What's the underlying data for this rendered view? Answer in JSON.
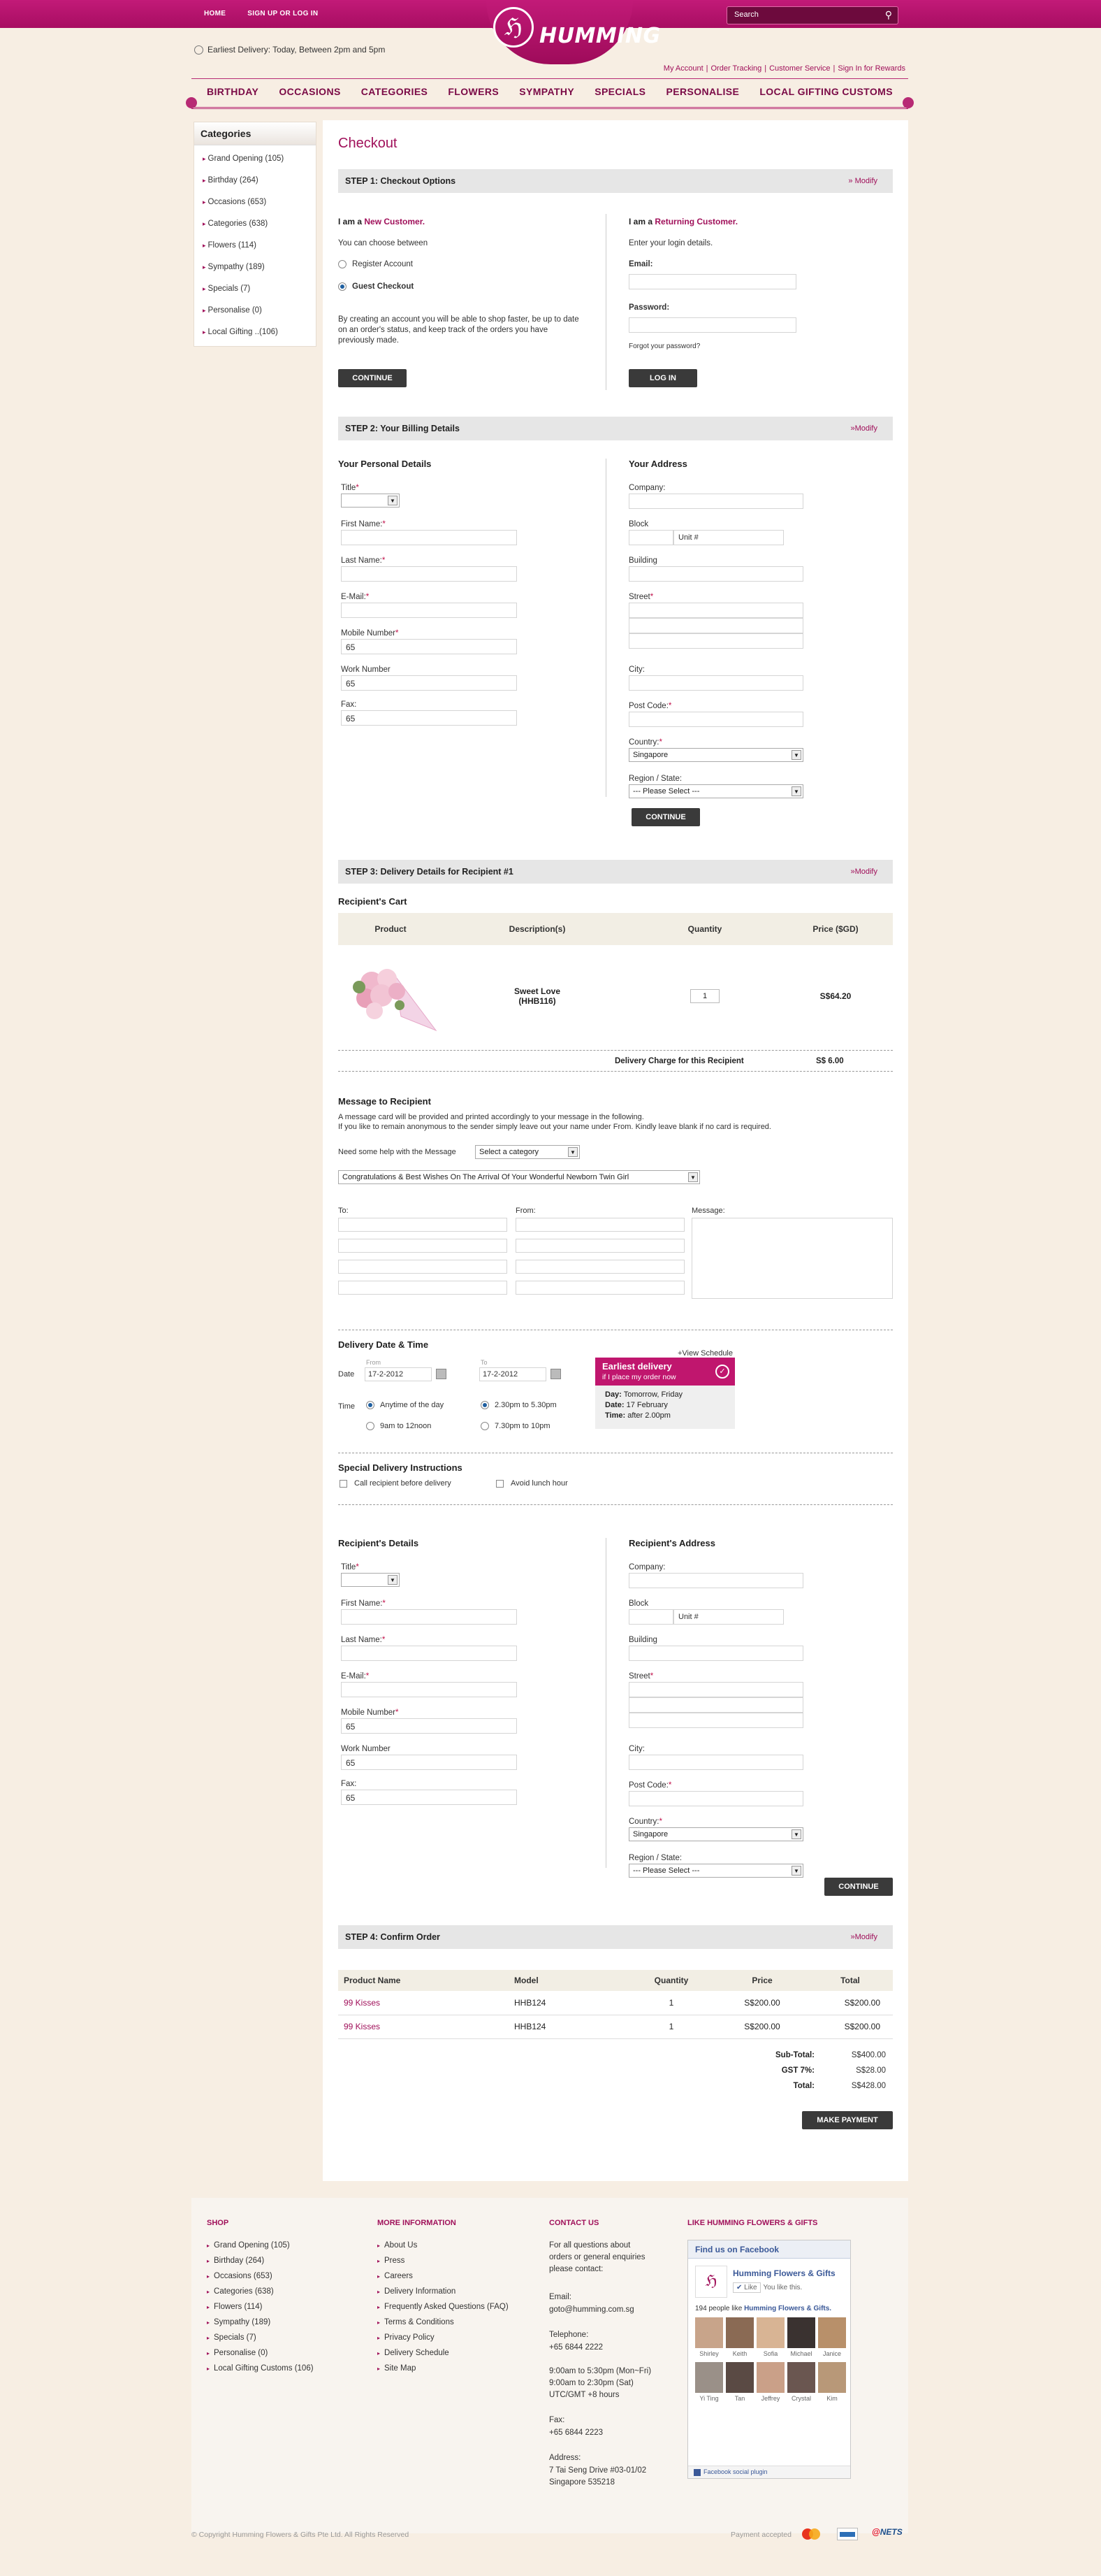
{
  "topnav": {
    "home": "HOME",
    "signup": "SIGN UP OR LOG IN"
  },
  "logo": {
    "text": "HUMMING",
    "mark": "ℌ"
  },
  "search": {
    "placeholder": "Search",
    "icon": "search-icon"
  },
  "earliest_delivery": "Earliest Delivery: Today, Between 2pm and 5pm",
  "account_links": [
    "My Account",
    "Order Tracking",
    "Customer Service",
    "Sign In for Rewards"
  ],
  "main_nav": [
    "BIRTHDAY",
    "OCCASIONS",
    "CATEGORIES",
    "FLOWERS",
    "SYMPATHY",
    "SPECIALS",
    "PERSONALISE",
    "LOCAL GIFTING CUSTOMS"
  ],
  "sidebar": {
    "title": "Categories",
    "items": [
      "Grand Opening (105)",
      "Birthday (264)",
      "Occasions (653)",
      "Categories (638)",
      "Flowers (114)",
      "Sympathy (189)",
      "Specials (7)",
      "Personalise (0)",
      "Local Gifting ..(106)"
    ]
  },
  "page_title": "Checkout",
  "step1": {
    "title": "STEP 1: Checkout Options",
    "modify": "» Modify",
    "new_prefix": "I am a ",
    "new_highlight": "New Customer.",
    "choose": "You can choose between",
    "register": "Register Account",
    "guest": "Guest Checkout",
    "desc": "By creating an account you will be able to shop faster, be up to date on an order's status, and keep track of the orders you have previously made.",
    "continue": "CONTINUE",
    "ret_prefix": "I am a ",
    "ret_highlight": "Returning Customer.",
    "enter": "Enter your login details.",
    "email": "Email:",
    "password": "Password:",
    "forgot": "Forgot your password?",
    "login": "LOG IN"
  },
  "step2": {
    "title": "STEP 2: Your Billing Details",
    "modify": "»Modify",
    "personal": "Your Personal Details",
    "address": "Your Address",
    "title_lbl": "Title",
    "first": "First Name:",
    "last": "Last Name:",
    "email": "E-Mail:",
    "mobile": "Mobile Number",
    "work": "Work Number",
    "fax": "Fax:",
    "code": "65",
    "company": "Company:",
    "block": "Block",
    "unit": "Unit #",
    "building": "Building",
    "street": "Street",
    "city": "City:",
    "post": "Post Code:",
    "country": "Country:",
    "country_val": "Singapore",
    "region": "Region / State:",
    "region_val": " --- Please Select --- ",
    "continue": "CONTINUE"
  },
  "step3": {
    "title": "STEP 3: Delivery Details for Recipient #1",
    "modify": "»Modify",
    "cart": "Recipient's Cart",
    "cols": [
      "Product",
      "Description(s)",
      "Quantity",
      "Price ($GD)"
    ],
    "product_name": "Sweet Love",
    "product_code": "(HHB116)",
    "qty": "1",
    "price": "S$64.20",
    "delivery_charge_lbl": "Delivery Charge for this Recipient",
    "delivery_charge": "S$ 6.00",
    "msg_title": "Message to Recipient",
    "msg_line1": "A message card will be provided and printed accordingly to your message in the following.",
    "msg_line2": "If you like to remain anonymous to the sender simply leave out your name under From. Kindly leave blank if no card is required.",
    "need_help": "Need some help with the Message",
    "select_cat": "Select a category",
    "message_template": "Congratulations & Best Wishes On The Arrival Of Your Wonderful Newborn Twin Girl",
    "to": "To:",
    "from": "From:",
    "message": "Message:",
    "dd_title": "Delivery Date & Time",
    "view_schedule": "+View Schedule",
    "date_lbl": "Date",
    "from_lbl": "From",
    "to_lbl": "To",
    "date_from": "17-2-2012",
    "date_to": "17-2-2012",
    "time_lbl": "Time",
    "t1": "Anytime of the day",
    "t2": "2.30pm to 5.30pm",
    "t3": "9am to 12noon",
    "t4": "7.30pm to 10pm",
    "early_title": "Earliest delivery",
    "early_sub": "if I place my order now",
    "early_day_lbl": "Day:",
    "early_day": "Tomorrow, Friday",
    "early_date_lbl": "Date:",
    "early_date": "17 February",
    "early_time_lbl": "Time:",
    "early_time": "after 2.00pm",
    "sdi_title": "Special Delivery Instructions",
    "call": "Call recipient before delivery",
    "avoid": "Avoid lunch hour",
    "rec_details": "Recipient's Details",
    "rec_address": "Recipient's Address",
    "continue": "CONTINUE"
  },
  "step4": {
    "title": "STEP 4: Confirm Order",
    "modify": "»Modify",
    "cols": [
      "Product Name",
      "Model",
      "Quantity",
      "Price",
      "Total"
    ],
    "rows": [
      [
        "99 Kisses",
        "HHB124",
        "1",
        "S$200.00",
        "S$200.00"
      ],
      [
        "99 Kisses",
        "HHB124",
        "1",
        "S$200.00",
        "S$200.00"
      ]
    ],
    "subtotal_lbl": "Sub-Total:",
    "subtotal": "S$400.00",
    "gst_lbl": "GST 7%:",
    "gst": "S$28.00",
    "total_lbl": "Total:",
    "total": "S$428.00",
    "pay": "MAKE PAYMENT"
  },
  "footer": {
    "shop_title": "SHOP",
    "shop": [
      "Grand Opening (105)",
      "Birthday (264)",
      "Occasions (653)",
      "Categories (638)",
      "Flowers (114)",
      "Sympathy (189)",
      "Specials (7)",
      "Personalise (0)",
      "Local Gifting Customs (106)"
    ],
    "more_title": "MORE INFORMATION",
    "more": [
      "About Us",
      "Press",
      "Careers",
      "Delivery Information",
      "Frequently Asked Questions (FAQ)",
      "Terms & Conditions",
      "Privacy Policy",
      "Delivery Schedule",
      "Site Map"
    ],
    "contact_title": "CONTACT US",
    "contact_intro": "For all questions about orders or general enquiries please contact:",
    "email_lbl": "Email:",
    "email": "goto@humming.com.sg",
    "tel_lbl": "Telephone:",
    "tel": "+65 6844 2222",
    "hours1": "9:00am to 5:30pm (Mon~Fri)",
    "hours2": "9:00am to 2:30pm (Sat)",
    "hours3": "UTC/GMT +8 hours",
    "fax_lbl": "Fax:",
    "fax": "+65 6844 2223",
    "addr_lbl": "Address:",
    "addr1": "7 Tai Seng Drive #03-01/02",
    "addr2": "Singapore 535218",
    "fb_title": "LIKE HUMMING FLOWERS & GIFTS",
    "fb_find": "Find us on Facebook",
    "fb_page": "Humming Flowers & Gifts",
    "fb_like": "Like",
    "fb_you": "You like this.",
    "fb_count": "194 people like ",
    "fb_count_name": "Humming Flowers & Gifts.",
    "fb_people": [
      "Shirley",
      "Keith",
      "Sofia",
      "Michael",
      "Janice",
      "Yi Ting",
      "Tan",
      "Jeffrey",
      "Crystal",
      "Kim"
    ],
    "fb_plugin": "Facebook social plugin"
  },
  "copyright": "© Copyright Humming Flowers & Gifts Pte Ltd. All Rights Reserved",
  "payment_lbl": "Payment accepted",
  "payment_nets": "NETS",
  "colors": {
    "brand": "#a80d62",
    "accent": "#c21a78",
    "dark_button": "#3a3a3a"
  }
}
